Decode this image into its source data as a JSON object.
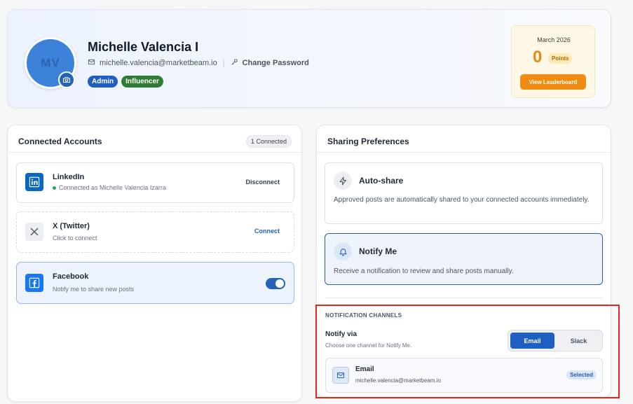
{
  "profile": {
    "initials": "MV",
    "name": "Michelle Valencia I",
    "email": "michelle.valencia@marketbeam.io",
    "change_password": "Change Password",
    "badges": [
      "Admin",
      "Influencer"
    ],
    "points_month": "March 2026",
    "points_value": "0",
    "points_label": "Points",
    "leaderboard_button": "View Leaderboard"
  },
  "connected_accounts": {
    "title": "Connected Accounts",
    "count_label": "1 Connected",
    "items": [
      {
        "name": "LinkedIn",
        "status": "Connected as Michelle Valencia Izarra",
        "action": "Disconnect"
      },
      {
        "name": "X (Twitter)",
        "status": "Click to connect",
        "action": "Connect"
      },
      {
        "name": "Facebook",
        "status": "Notify me to share new posts",
        "toggle": "on"
      }
    ]
  },
  "sharing_preferences": {
    "title": "Sharing Preferences",
    "options": [
      {
        "title": "Auto-share",
        "description": "Approved posts are automatically shared to your connected accounts immediately.",
        "icon": "lightning-icon"
      },
      {
        "title": "Notify Me",
        "description": "Receive a notification to review and share posts manually.",
        "icon": "bell-icon",
        "selected": true
      }
    ],
    "notification_channels": {
      "title": "NOTIFICATION CHANNELS",
      "notify_via": "Notify via",
      "notify_via_sub": "Choose one channel for Notify Me.",
      "segments": [
        "Email",
        "Slack"
      ],
      "active_segment": "Email",
      "channel_title": "Email",
      "channel_value": "michelle.valencia@marketbeam.io",
      "channel_badge": "Selected"
    }
  },
  "colors": {
    "primary": "#1f5fc4",
    "accent_orange": "#f08c12",
    "highlight_border": "#e5241b"
  }
}
